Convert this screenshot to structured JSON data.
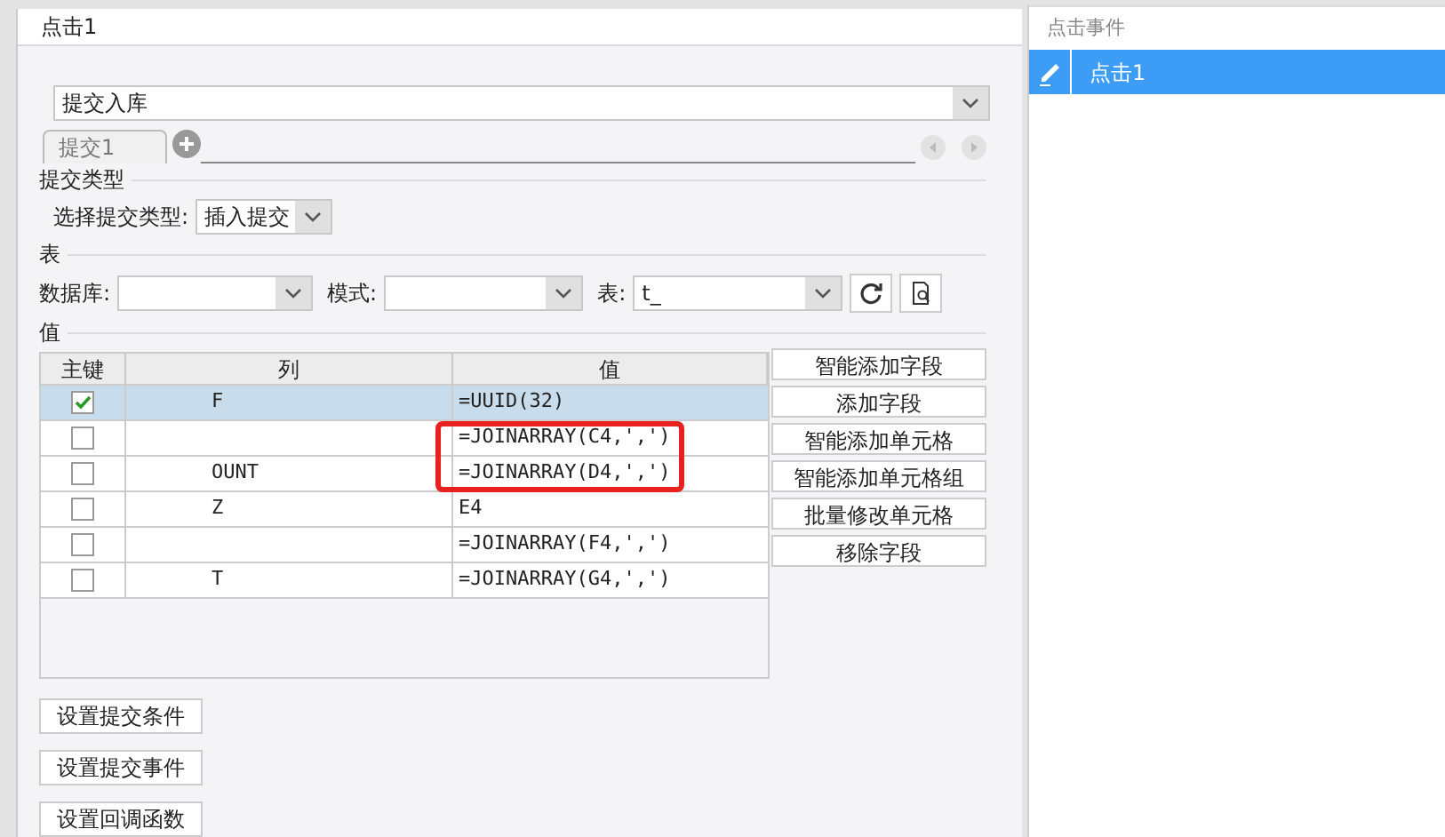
{
  "dialog": {
    "title": "点击1"
  },
  "action": {
    "value": "提交入库"
  },
  "tabs": [
    {
      "label": "提交1",
      "selected": true
    }
  ],
  "submit_type": {
    "heading": "提交类型",
    "label": "选择提交类型:",
    "value": "插入提交"
  },
  "table_section": {
    "heading": "表",
    "database_label": "数据库:",
    "schema_label": "模式:",
    "table_label": "表:",
    "table_value": "t_"
  },
  "values_section": {
    "heading": "值",
    "columns": [
      "主键",
      "列",
      "值"
    ],
    "rows": [
      {
        "primary_key": true,
        "column": "F",
        "value": "=UUID(32)",
        "selected": true
      },
      {
        "primary_key": false,
        "column": "",
        "value": "=JOINARRAY(C4,',')",
        "selected": false
      },
      {
        "primary_key": false,
        "column": "OUNT",
        "value": "=JOINARRAY(D4,',')",
        "selected": false
      },
      {
        "primary_key": false,
        "column": "Z",
        "value": "E4",
        "selected": false
      },
      {
        "primary_key": false,
        "column": "",
        "value": "=JOINARRAY(F4,',')",
        "selected": false
      },
      {
        "primary_key": false,
        "column": "T",
        "value": "=JOINARRAY(G4,',')",
        "selected": false
      }
    ],
    "buttons": [
      "智能添加字段",
      "添加字段",
      "智能添加单元格",
      "智能添加单元格组",
      "批量修改单元格",
      "移除字段"
    ]
  },
  "bottom_buttons": [
    "设置提交条件",
    "设置提交事件",
    "设置回调函数"
  ],
  "events_panel": {
    "heading": "点击事件",
    "items": [
      {
        "label": "点击1",
        "selected": true
      }
    ]
  }
}
